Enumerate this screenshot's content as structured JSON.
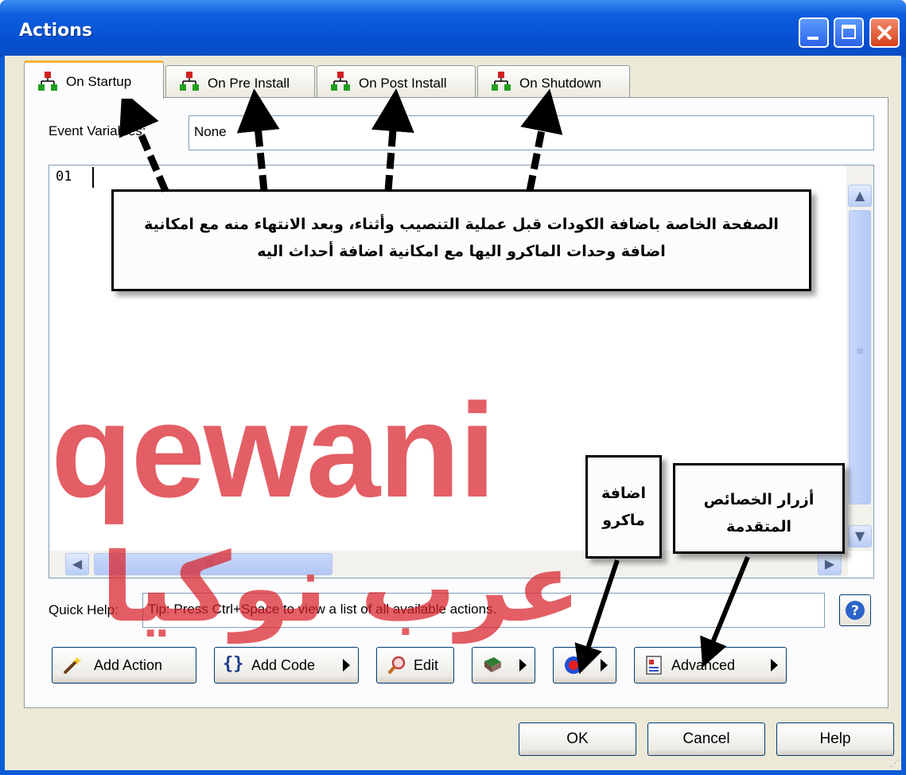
{
  "window": {
    "title": "Actions"
  },
  "tabs": [
    {
      "label": "On Startup",
      "active": true
    },
    {
      "label": "On Pre Install",
      "active": false
    },
    {
      "label": "On Post Install",
      "active": false
    },
    {
      "label": "On Shutdown",
      "active": false
    }
  ],
  "event_variables": {
    "label": "Event Variables:",
    "value": "None"
  },
  "editor": {
    "line_number": "01"
  },
  "quick_help": {
    "label": "Quick Help:",
    "value": "Tip: Press Ctrl+Space to view a list of all available actions."
  },
  "action_buttons": {
    "add_action": "Add Action",
    "add_code": "Add Code",
    "edit": "Edit",
    "advanced": "Advanced"
  },
  "dialog_buttons": {
    "ok": "OK",
    "cancel": "Cancel",
    "help": "Help"
  },
  "annotations": {
    "main": "الصفحة الخاصة باضافة الكودات قبل عملية التنصيب وأثناء، وبعد الانتهاء منه مع امكانية اضافة وحدات الماكرو اليها مع امكانية اضافة أحداث اليه",
    "macro_line1": "اضافة",
    "macro_line2": "ماكرو",
    "advanced_line1": "أزرار الخصائص",
    "advanced_line2": "المتقدمة"
  },
  "watermark": {
    "latin": "qewani",
    "arabic": "عرب نوكيا"
  },
  "colors": {
    "titlebar": "#0550d0",
    "dialog_bg": "#ece9d8",
    "watermark": "#d9222a",
    "active_tab_accent": "#f5b338"
  }
}
